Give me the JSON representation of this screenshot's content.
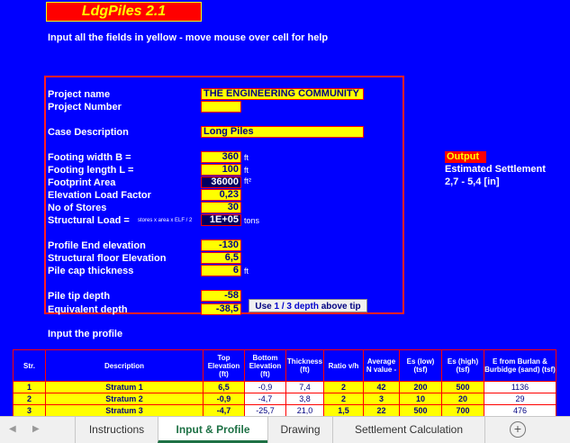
{
  "app": {
    "title": "LdgPiles 2.1",
    "instruction": "Input all the fields in yellow - move mouse over cell for help"
  },
  "form": {
    "project_name": {
      "label": "Project name",
      "value": "THE ENGINEERING COMMUNITY"
    },
    "project_number": {
      "label": "Project Number",
      "value": ""
    },
    "case_description": {
      "label": "Case Description",
      "value": "Long Piles"
    },
    "footing_width": {
      "label": "Footing width   B =",
      "value": "360",
      "unit": "ft"
    },
    "footing_length": {
      "label": "Footing length   L =",
      "value": "100",
      "unit": "ft"
    },
    "footprint_area": {
      "label": "Footprint Area",
      "value": "36000",
      "unit": "ft²"
    },
    "elevation_load_factor": {
      "label": "Elevation Load Factor",
      "value": "0,23"
    },
    "no_of_stores": {
      "label": "No of Stores",
      "value": "30"
    },
    "structural_load": {
      "label": "Structural Load =",
      "formula": "stores x area x ELF / 2",
      "value": "1E+05",
      "unit": "tons"
    },
    "profile_end_elevation": {
      "label": "Profile End elevation",
      "value": "-130"
    },
    "structural_floor_elevation": {
      "label": "Structural floor Elevation",
      "value": "6,5"
    },
    "pile_cap_thickness": {
      "label": "Pile cap thickness",
      "value": "6",
      "unit": "ft"
    },
    "pile_tip_depth": {
      "label": "Pile tip depth",
      "value": "-58"
    },
    "equivalent_depth": {
      "label": "Equivalent depth",
      "value": "-38,5"
    },
    "depth_button": {
      "label_a": "Use ",
      "label_b": "1 / 3 depth",
      "label_c": " above tip"
    }
  },
  "output": {
    "header": "Output",
    "label": "Estimated Settlement",
    "value": "2,7 - 5,4 [in]"
  },
  "profile": {
    "label": "Input the profile",
    "headers": [
      "Str.",
      "Description",
      "Top Elevation (ft)",
      "Bottom Elevation (ft)",
      "Thickness (ft)",
      "Ratio v/h",
      "Average N value -",
      "Es (low) (tsf)",
      "Es (high) (tsf)",
      "E from Burlan & Burbidge (sand) (tsf)"
    ],
    "rows": [
      [
        "1",
        "Stratum 1",
        "6,5",
        "-0,9",
        "7,4",
        "2",
        "42",
        "200",
        "500",
        "1136"
      ],
      [
        "2",
        "Stratum 2",
        "-0,9",
        "-4,7",
        "3,8",
        "2",
        "3",
        "10",
        "20",
        "29"
      ],
      [
        "3",
        "Stratum 3",
        "-4,7",
        "-25,7",
        "21,0",
        "1,5",
        "22",
        "500",
        "700",
        "476"
      ]
    ]
  },
  "tabs": [
    "Instructions",
    "Input & Profile",
    "Drawing",
    "Settlement Calculation"
  ],
  "colors": {
    "background": "#0000ff",
    "input": "#ffff00",
    "border": "#ff0000",
    "active_tab": "#1e7145"
  }
}
